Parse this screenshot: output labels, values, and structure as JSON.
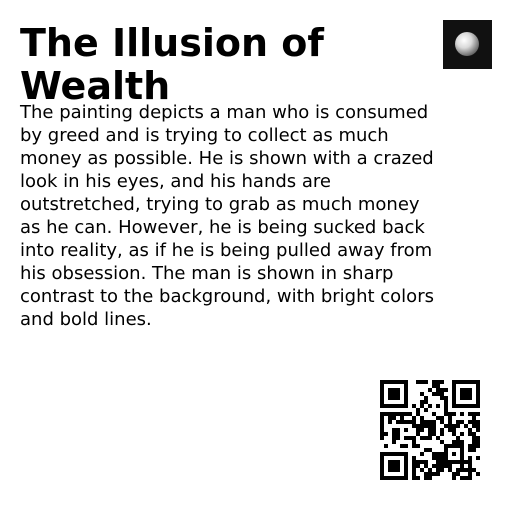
{
  "card": {
    "title": "The Illusion of Wealth",
    "description": "The painting depicts a man who is consumed by greed and is trying to collect as much money as possible. He is shown with a crazed look in his eyes, and his hands are outstretched, trying to grab as much money as he can. However, he is being sucked back into reality, as if he is being pulled away from his obsession. The man is shown in sharp contrast to the background, with bright colors and bold lines."
  },
  "thumbnail": {
    "icon": "sphere-icon",
    "background_color": "#111111",
    "sphere_color": "#e8e8e8"
  },
  "qr_code": {
    "icon": "qr-code-icon",
    "color": "#000000"
  }
}
